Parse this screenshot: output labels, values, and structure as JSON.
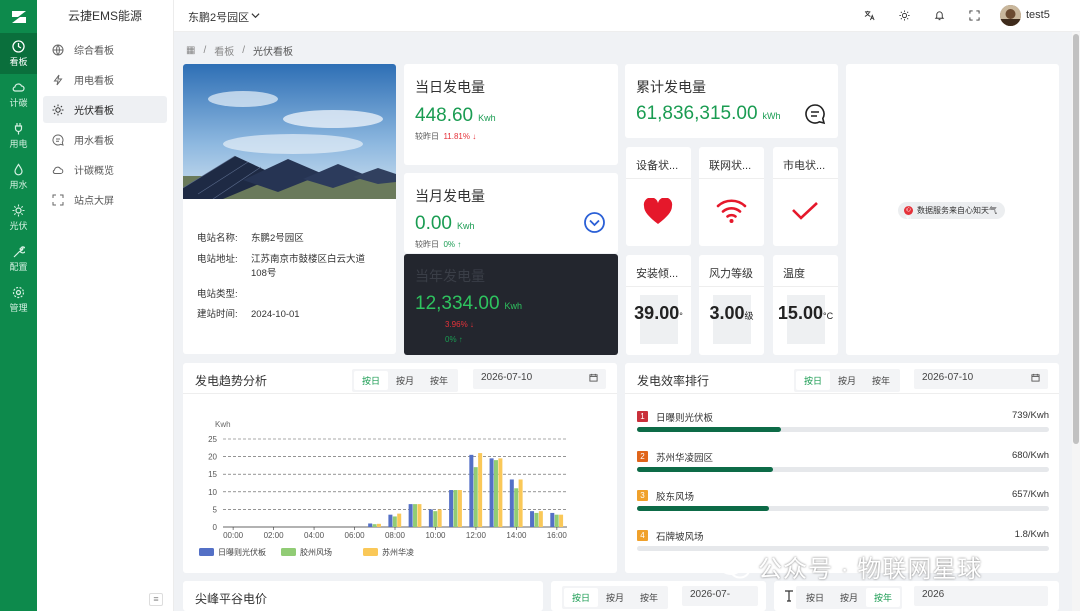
{
  "app": {
    "title": "云捷EMS能源"
  },
  "rail": [
    {
      "label": "看板",
      "icon": "dashboard-icon",
      "active": true
    },
    {
      "label": "计碳",
      "icon": "cloud-icon",
      "active": false
    },
    {
      "label": "用电",
      "icon": "plug-icon",
      "active": false
    },
    {
      "label": "用水",
      "icon": "water-drop-icon",
      "active": false
    },
    {
      "label": "光伏",
      "icon": "sun-icon",
      "active": false
    },
    {
      "label": "配置",
      "icon": "gear-icon",
      "active": false
    },
    {
      "label": "管理",
      "icon": "settings-icon",
      "active": false
    }
  ],
  "sidebar": {
    "items": [
      {
        "label": "综合看板",
        "icon": "globe-icon",
        "active": false
      },
      {
        "label": "用电看板",
        "icon": "lightning-icon",
        "active": false
      },
      {
        "label": "光伏看板",
        "icon": "sun-icon",
        "active": true
      },
      {
        "label": "用水看板",
        "icon": "chat-icon",
        "active": false
      },
      {
        "label": "计碳概览",
        "icon": "cloud-icon",
        "active": false
      },
      {
        "label": "站点大屏",
        "icon": "fullscreen-icon",
        "active": false
      }
    ],
    "collapse": "≡"
  },
  "header": {
    "park": "东鹏2号园区",
    "user": "test5"
  },
  "breadcrumb": {
    "home": "▦",
    "level1": "看板",
    "level2": "光伏看板",
    "sep": "/"
  },
  "station": {
    "name_k": "电站名称:",
    "name_v": "东鹏2号园区",
    "addr_k": "电站地址:",
    "addr_v1": "江苏南京市鼓楼区白云大道",
    "addr_v2": "108号",
    "type_k": "电站类型:",
    "type_v": "",
    "time_k": "建站时间:",
    "time_v": "2024-10-01"
  },
  "daily": {
    "title": "当日发电量",
    "value": "448.60",
    "unit": "Kwh",
    "cmp_label": "较昨日",
    "cmp_value": "11.81%",
    "arrow": "↓"
  },
  "monthly": {
    "title": "当月发电量",
    "value": "0.00",
    "unit": "Kwh",
    "cmp_label": "较昨日",
    "cmp_value": "0%",
    "arrow": "↑"
  },
  "yearly": {
    "title": "当年发电量",
    "value": "12,334.00",
    "unit": "Kwh",
    "cmp1": "3.96%",
    "arrow1": "↓",
    "cmp2": "0%",
    "arrow2": "↑"
  },
  "total": {
    "title": "累计发电量",
    "value": "61,836,315.00",
    "unit": "kWh"
  },
  "status": [
    {
      "title": "设备状...",
      "icon": "heart-icon"
    },
    {
      "title": "联网状...",
      "icon": "wifi-icon"
    },
    {
      "title": "市电状...",
      "icon": "check-icon"
    }
  ],
  "metrics": [
    {
      "title": "安装倾...",
      "value": "39.00",
      "unit": "°"
    },
    {
      "title": "风力等级",
      "value": "3.00",
      "unit": "级"
    },
    {
      "title": "温度",
      "value": "15.00",
      "unit": "°C"
    }
  ],
  "weather": {
    "badge": "数据服务来自心知天气",
    "dot": "心知"
  },
  "trend": {
    "title": "发电趋势分析",
    "tabs": [
      "按日",
      "按月",
      "按年"
    ],
    "active_tab": 0,
    "date": "2026-07-10"
  },
  "ranking": {
    "title": "发电效率排行",
    "tabs": [
      "按日",
      "按月",
      "按年"
    ],
    "active_tab": 0,
    "date": "2026-07-10",
    "items": [
      {
        "rank": "1",
        "name": "日曝则光伏板",
        "value": "739/Kwh",
        "ratio": 0.35,
        "color": "#c9303a"
      },
      {
        "rank": "2",
        "name": "苏州华凌园区",
        "value": "680/Kwh",
        "ratio": 0.33,
        "color": "#e0651b"
      },
      {
        "rank": "3",
        "name": "胶东风场",
        "value": "657/Kwh",
        "ratio": 0.32,
        "color": "#f0a12b"
      },
      {
        "rank": "4",
        "name": "石牌坡风场",
        "value": "1.8/Kwh",
        "ratio": 0.0,
        "color": "#f0a12b"
      }
    ]
  },
  "peak": {
    "title": "尖峰平谷电价",
    "tabs": [
      "按日",
      "按月",
      "按年"
    ],
    "active_tab": 0,
    "date": "2026-07-"
  },
  "bottom_right": {
    "tabs": [
      "按日",
      "按月",
      "按年"
    ],
    "active_tab": 2,
    "date": "2026"
  },
  "watermark": {
    "text": "公众号 · 物联网星球"
  },
  "chart_data": {
    "type": "bar",
    "ylabel": "Kwh",
    "ylim": [
      0,
      25
    ],
    "yticks": [
      "0",
      "5",
      "10",
      "15",
      "20",
      "25"
    ],
    "grid": true,
    "legend_position": "bottom-left",
    "categories": [
      "00:00",
      "01:00",
      "02:00",
      "03:00",
      "04:00",
      "05:00",
      "06:00",
      "07:00",
      "08:00",
      "09:00",
      "10:00",
      "11:00",
      "12:00",
      "13:00",
      "14:00",
      "15:00",
      "16:00"
    ],
    "xtick_labels": [
      "00:00",
      "02:00",
      "04:00",
      "06:00",
      "08:00",
      "10:00",
      "12:00",
      "14:00",
      "16:00"
    ],
    "series": [
      {
        "name": "日曝则光伏板",
        "color": "#5470c6",
        "values": [
          0,
          0,
          0,
          0,
          0,
          0,
          0,
          1.0,
          3.5,
          6.5,
          5.0,
          10.5,
          20.5,
          19.5,
          13.5,
          4.5,
          4.0
        ]
      },
      {
        "name": "胶州风场",
        "color": "#91cc75",
        "values": [
          0,
          0,
          0,
          0,
          0,
          0,
          0,
          0.8,
          3.0,
          6.5,
          4.5,
          10.5,
          17.0,
          19.0,
          11.0,
          4.0,
          3.5
        ]
      },
      {
        "name": "苏州华凌",
        "color": "#fac858",
        "values": [
          0,
          0,
          0,
          0,
          0,
          0,
          0,
          0.9,
          3.8,
          6.5,
          5.0,
          10.5,
          21.0,
          19.5,
          13.5,
          4.5,
          3.5
        ]
      }
    ]
  }
}
